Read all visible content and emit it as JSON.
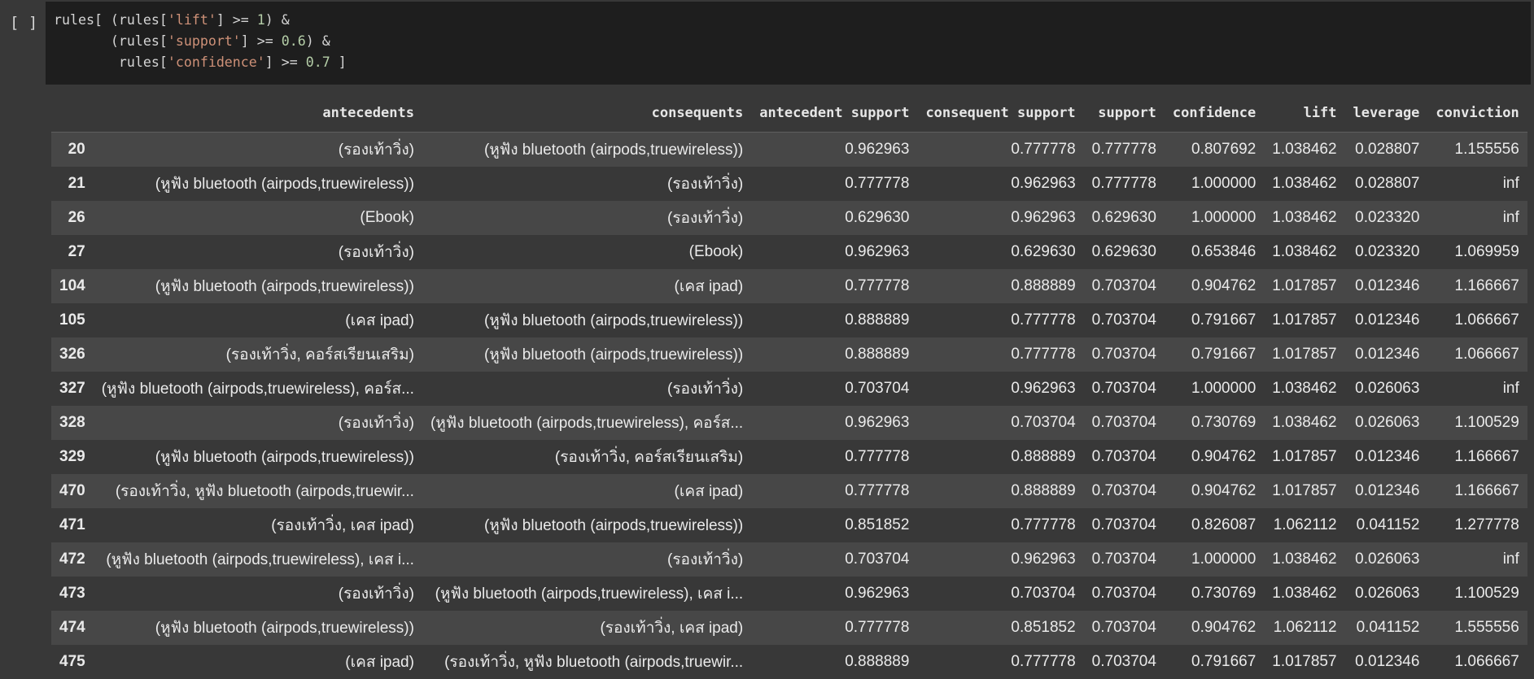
{
  "cell": {
    "run_indicator": "[ ]",
    "code_lines": [
      [
        {
          "t": "plain",
          "v": "rules[ (rules["
        },
        {
          "t": "str",
          "v": "'lift'"
        },
        {
          "t": "plain",
          "v": "] >= "
        },
        {
          "t": "num",
          "v": "1"
        },
        {
          "t": "plain",
          "v": ") &"
        }
      ],
      [
        {
          "t": "plain",
          "v": "       (rules["
        },
        {
          "t": "str",
          "v": "'support'"
        },
        {
          "t": "plain",
          "v": "] >= "
        },
        {
          "t": "num",
          "v": "0.6"
        },
        {
          "t": "plain",
          "v": ") &"
        }
      ],
      [
        {
          "t": "plain",
          "v": "        rules["
        },
        {
          "t": "str",
          "v": "'confidence'"
        },
        {
          "t": "plain",
          "v": "] >= "
        },
        {
          "t": "num",
          "v": "0.7"
        },
        {
          "t": "plain",
          "v": " ]"
        }
      ]
    ]
  },
  "table": {
    "columns": [
      "",
      "antecedents",
      "consequents",
      "antecedent support",
      "consequent support",
      "support",
      "confidence",
      "lift",
      "leverage",
      "conviction"
    ],
    "rows": [
      [
        "20",
        "(รองเท้าวิ่ง)",
        "(หูฟัง bluetooth (airpods,truewireless))",
        "0.962963",
        "0.777778",
        "0.777778",
        "0.807692",
        "1.038462",
        "0.028807",
        "1.155556"
      ],
      [
        "21",
        "(หูฟัง bluetooth (airpods,truewireless))",
        "(รองเท้าวิ่ง)",
        "0.777778",
        "0.962963",
        "0.777778",
        "1.000000",
        "1.038462",
        "0.028807",
        "inf"
      ],
      [
        "26",
        "(Ebook)",
        "(รองเท้าวิ่ง)",
        "0.629630",
        "0.962963",
        "0.629630",
        "1.000000",
        "1.038462",
        "0.023320",
        "inf"
      ],
      [
        "27",
        "(รองเท้าวิ่ง)",
        "(Ebook)",
        "0.962963",
        "0.629630",
        "0.629630",
        "0.653846",
        "1.038462",
        "0.023320",
        "1.069959"
      ],
      [
        "104",
        "(หูฟัง bluetooth (airpods,truewireless))",
        "(เคส ipad)",
        "0.777778",
        "0.888889",
        "0.703704",
        "0.904762",
        "1.017857",
        "0.012346",
        "1.166667"
      ],
      [
        "105",
        "(เคส ipad)",
        "(หูฟัง bluetooth (airpods,truewireless))",
        "0.888889",
        "0.777778",
        "0.703704",
        "0.791667",
        "1.017857",
        "0.012346",
        "1.066667"
      ],
      [
        "326",
        "(รองเท้าวิ่ง, คอร์สเรียนเสริม)",
        "(หูฟัง bluetooth (airpods,truewireless))",
        "0.888889",
        "0.777778",
        "0.703704",
        "0.791667",
        "1.017857",
        "0.012346",
        "1.066667"
      ],
      [
        "327",
        "(หูฟัง bluetooth (airpods,truewireless), คอร์ส...",
        "(รองเท้าวิ่ง)",
        "0.703704",
        "0.962963",
        "0.703704",
        "1.000000",
        "1.038462",
        "0.026063",
        "inf"
      ],
      [
        "328",
        "(รองเท้าวิ่ง)",
        "(หูฟัง bluetooth (airpods,truewireless), คอร์ส...",
        "0.962963",
        "0.703704",
        "0.703704",
        "0.730769",
        "1.038462",
        "0.026063",
        "1.100529"
      ],
      [
        "329",
        "(หูฟัง bluetooth (airpods,truewireless))",
        "(รองเท้าวิ่ง, คอร์สเรียนเสริม)",
        "0.777778",
        "0.888889",
        "0.703704",
        "0.904762",
        "1.017857",
        "0.012346",
        "1.166667"
      ],
      [
        "470",
        "(รองเท้าวิ่ง, หูฟัง bluetooth (airpods,truewir...",
        "(เคส ipad)",
        "0.777778",
        "0.888889",
        "0.703704",
        "0.904762",
        "1.017857",
        "0.012346",
        "1.166667"
      ],
      [
        "471",
        "(รองเท้าวิ่ง, เคส ipad)",
        "(หูฟัง bluetooth (airpods,truewireless))",
        "0.851852",
        "0.777778",
        "0.703704",
        "0.826087",
        "1.062112",
        "0.041152",
        "1.277778"
      ],
      [
        "472",
        "(หูฟัง bluetooth (airpods,truewireless), เคส i...",
        "(รองเท้าวิ่ง)",
        "0.703704",
        "0.962963",
        "0.703704",
        "1.000000",
        "1.038462",
        "0.026063",
        "inf"
      ],
      [
        "473",
        "(รองเท้าวิ่ง)",
        "(หูฟัง bluetooth (airpods,truewireless), เคส i...",
        "0.962963",
        "0.703704",
        "0.703704",
        "0.730769",
        "1.038462",
        "0.026063",
        "1.100529"
      ],
      [
        "474",
        "(หูฟัง bluetooth (airpods,truewireless))",
        "(รองเท้าวิ่ง, เคส ipad)",
        "0.777778",
        "0.851852",
        "0.703704",
        "0.904762",
        "1.062112",
        "0.041152",
        "1.555556"
      ],
      [
        "475",
        "(เคส ipad)",
        "(รองเท้าวิ่ง, หูฟัง bluetooth (airpods,truewir...",
        "0.888889",
        "0.777778",
        "0.703704",
        "0.791667",
        "1.017857",
        "0.012346",
        "1.066667"
      ]
    ]
  },
  "colors": {
    "background": "#383838",
    "editor_background": "#1e1e1e",
    "row_alt": "#474747",
    "code_string": "#ce9178",
    "code_number": "#b5cea8"
  }
}
